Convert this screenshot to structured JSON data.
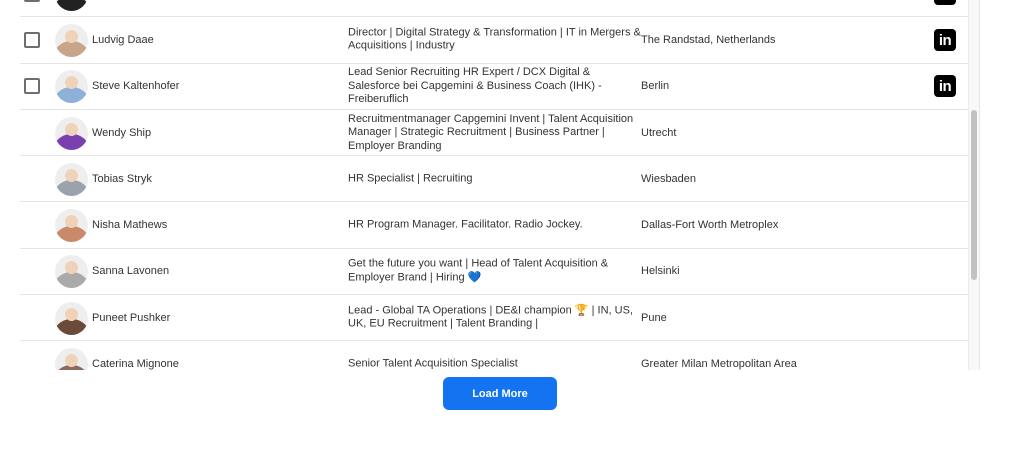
{
  "rows": [
    {
      "name": "",
      "title": "",
      "location": "",
      "checkbox": true,
      "linkedin": true,
      "avatar_color": "#222"
    },
    {
      "name": "Ludvig Daae",
      "title": "Director | Digital Strategy & Transformation | IT in Mergers & Acquisitions | Industry",
      "location": "The Randstad, Netherlands",
      "checkbox": true,
      "linkedin": true,
      "avatar_color": "#c8a58a"
    },
    {
      "name": "Steve Kaltenhofer",
      "title": "Lead Senior Recruiting HR Expert / DCX Digital & Salesforce bei Capgemini & Business Coach (IHK) - Freiberuflich",
      "location": "Berlin",
      "checkbox": true,
      "linkedin": true,
      "avatar_color": "#8fb0d8"
    },
    {
      "name": "Wendy Ship",
      "title": "Recruitmentmanager Capgemini Invent | Talent Acquisition Manager | Strategic Recruitment | Business Partner | Employer Branding",
      "location": "Utrecht",
      "checkbox": false,
      "linkedin": false,
      "avatar_color": "#7b3fb0"
    },
    {
      "name": "Tobias Stryk",
      "title": "HR Specialist | Recruiting",
      "location": "Wiesbaden",
      "checkbox": false,
      "linkedin": false,
      "avatar_color": "#9aa3ad"
    },
    {
      "name": "Nisha Mathews",
      "title": "HR Program Manager. Facilitator. Radio Jockey.",
      "location": "Dallas-Fort Worth Metroplex",
      "checkbox": false,
      "linkedin": false,
      "avatar_color": "#c98a6a"
    },
    {
      "name": "Sanna Lavonen",
      "title": "Get the future you want | Head of Talent Acquisition & Employer Brand | Hiring 💙",
      "location": "Helsinki",
      "checkbox": false,
      "linkedin": false,
      "avatar_color": "#aaa"
    },
    {
      "name": "Puneet Pushker",
      "title": "Lead - Global TA Operations | DE&I champion 🏆 | IN, US, UK, EU Recruitment | Talent Branding |",
      "location": "Pune",
      "checkbox": false,
      "linkedin": false,
      "avatar_color": "#6b4a3a"
    },
    {
      "name": "Caterina Mignone",
      "title": "Senior Talent Acquisition Specialist",
      "location": "Greater Milan Metropolitan Area",
      "checkbox": false,
      "linkedin": false,
      "avatar_color": "#8a6a5a"
    }
  ],
  "linkedin_label": "in",
  "load_more_label": "Load More"
}
